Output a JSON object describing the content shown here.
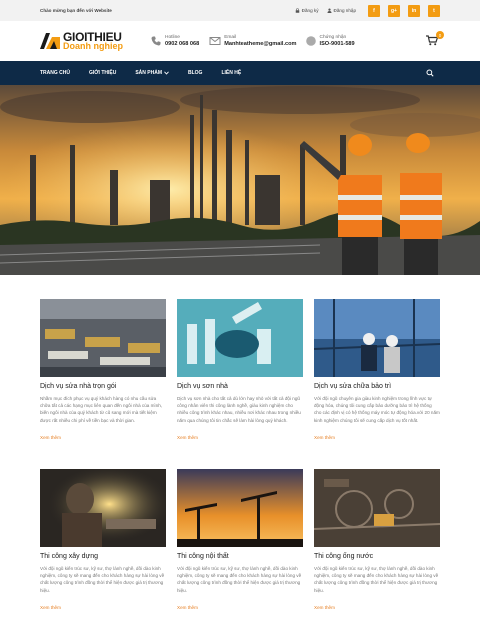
{
  "topbar": {
    "welcome": "Chào mừng bạn đến với Website",
    "register": "Đăng ký",
    "login": "Đăng nhập",
    "social": [
      "f",
      "g+",
      "in",
      "t"
    ],
    "accent": "#f39c12"
  },
  "header": {
    "logo_line1": "GIOITHIEU",
    "logo_line2": "Doanh nghiep",
    "hotline_label": "Hotline",
    "hotline_value": "0902 068 068",
    "email_label": "Email",
    "email_value": "Manhteatheme@gmail.com",
    "cert_label": "Chứng nhận",
    "cert_value": "ISO-9001-589",
    "cart_count": "0"
  },
  "nav": {
    "items": [
      "TRANG CHỦ",
      "GIỚI THIỆU",
      "SẢN PHẨM",
      "BLOG",
      "LIÊN HỆ"
    ],
    "bg": "#0e2a47"
  },
  "services": [
    {
      "title": "Dịch vụ sửa nhà trọn gói",
      "desc": "Nhằm mục đích phục vụ quý khách hàng có nhu cầu sửa chữa tất cả các hạng mục liên quan đến ngôi nhà của mình, biến ngôi nhà của quý khách từ cũ sang mới mà tiết kiệm được rất nhiều chi phí về tiền bạc và thời gian.",
      "more": "Xem thêm"
    },
    {
      "title": "Dịch vụ sơn nhà",
      "desc": "Dịch vụ sơn nhà cho tất cả dù lớn hay nhỏ với tất cả đội ngũ công nhân viên thi công lành nghề, giàu kinh nghiệm cho nhiều công trình khác nhau, nhiều nơi khác nhau trong nhiều năm qua chúng tôi tin chắc sẽ làm hài lòng quý khách.",
      "more": "Xem thêm"
    },
    {
      "title": "Dịch vụ sửa chữa bảo trì",
      "desc": "Với đội ngũ chuyên gia giàu kinh nghiệm trong lĩnh vực tự động hóa, chúng tôi cung cấp bảo dưỡng bảo trì hệ thống cho các định vị có hệ thống máy móc tự động hóa.với 20 năm kinh nghiệm chúng tôi sẽ cung cấp dịch vụ tốt nhất.",
      "more": "Xem thêm"
    },
    {
      "title": "Thi công xây dựng",
      "desc": "Với đội ngũ kiến trúc sư, kỹ sư, thợ lành nghề, dồi dào kinh nghiệm, công ty sẽ mang đến cho khách hàng sự hài lòng về chất lượng công trình đồng thời thể hiện được giá trị thương hiệu.",
      "more": "Xem thêm"
    },
    {
      "title": "Thi công nội thất",
      "desc": "Với đội ngũ kiến trúc sư, kỹ sư, thợ lành nghề, dồi dào kinh nghiệm, công ty sẽ mang đến cho khách hàng sự hài lòng về chất lượng công trình đồng thời thể hiện được giá trị thương hiệu.",
      "more": "Xem thêm"
    },
    {
      "title": "Thi công ống nước",
      "desc": "Với đội ngũ kiến trúc sư, kỹ sư, thợ lành nghề, dồi dào kinh nghiệm, công ty sẽ mang đến cho khách hàng sự hài lòng về chất lượng công trình đồng thời thể hiện được giá trị thương hiệu.",
      "more": "Xem thêm"
    }
  ]
}
